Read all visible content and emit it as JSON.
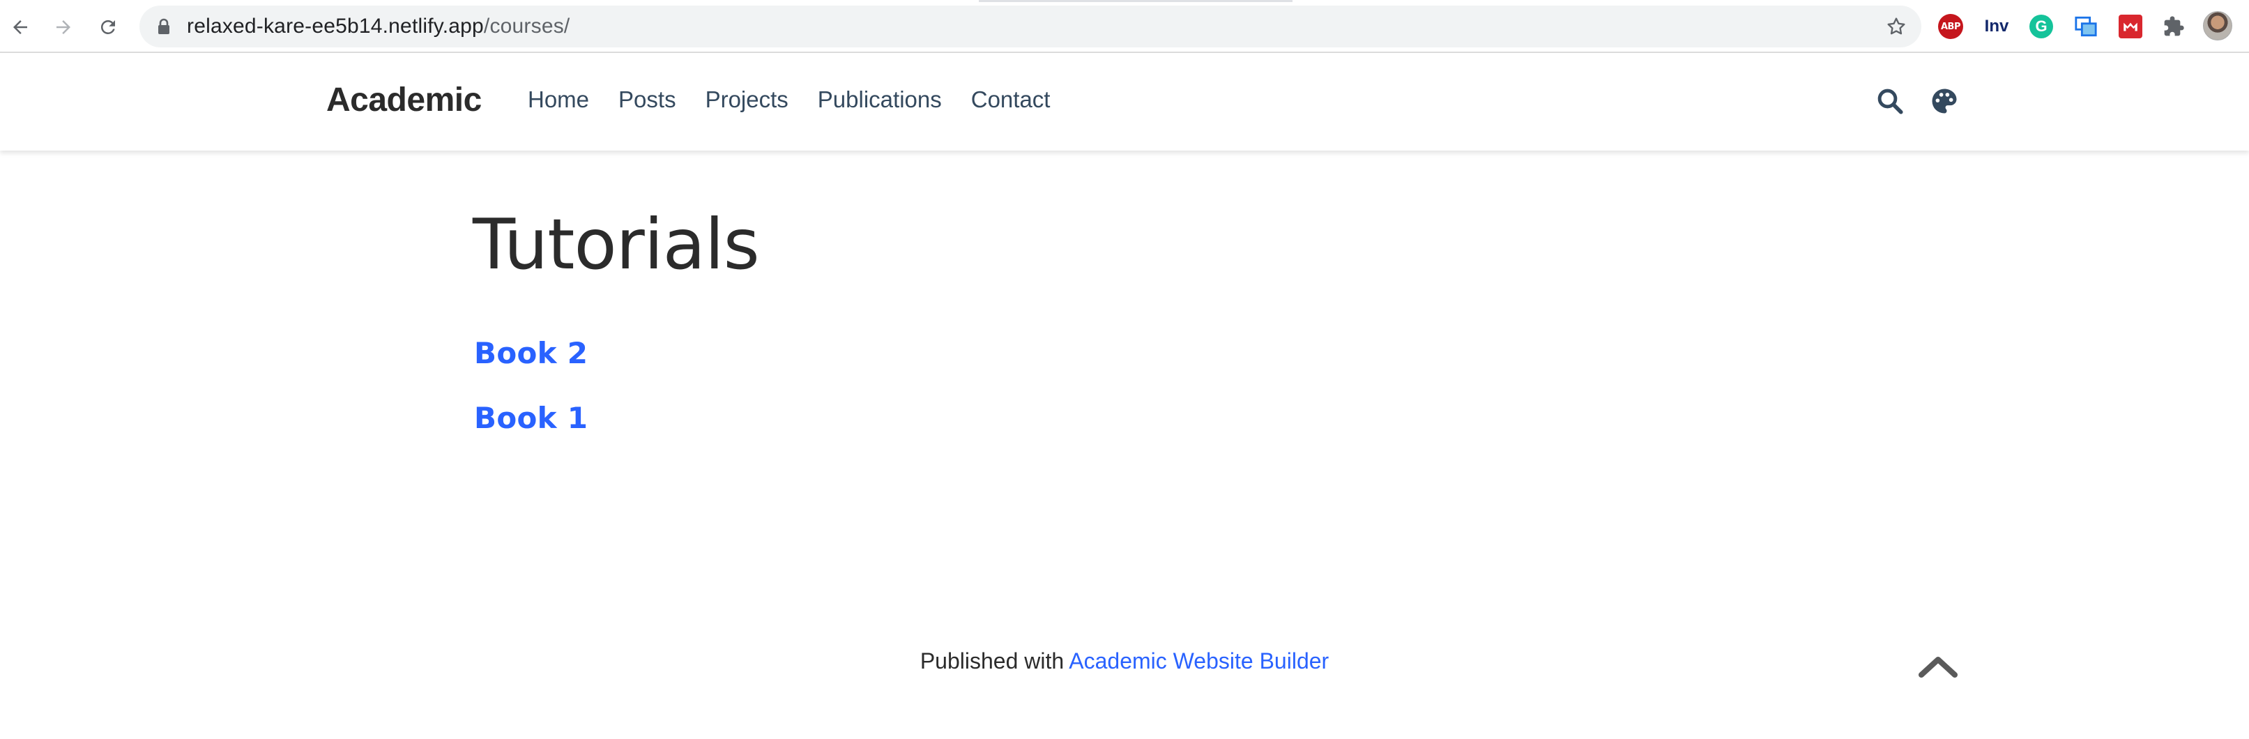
{
  "browser": {
    "url_host": "relaxed-kare-ee5b14.netlify.app",
    "url_path": "/courses/",
    "extensions": {
      "abp_label": "ABP",
      "inv_label": "Inv",
      "grammarly_label": "G"
    }
  },
  "navbar": {
    "brand": "Academic",
    "links": [
      {
        "label": "Home"
      },
      {
        "label": "Posts"
      },
      {
        "label": "Projects"
      },
      {
        "label": "Publications"
      },
      {
        "label": "Contact"
      }
    ],
    "icons": [
      "search-icon",
      "palette-icon"
    ]
  },
  "main": {
    "title": "Tutorials",
    "courses": [
      {
        "label": "Book 2"
      },
      {
        "label": "Book 1"
      }
    ]
  },
  "footer": {
    "prefix": "Published with",
    "link_label": "Academic Website Builder"
  },
  "colors": {
    "link_blue": "#2962ff",
    "nav_text": "#34495e",
    "text": "#2b2b2b"
  }
}
